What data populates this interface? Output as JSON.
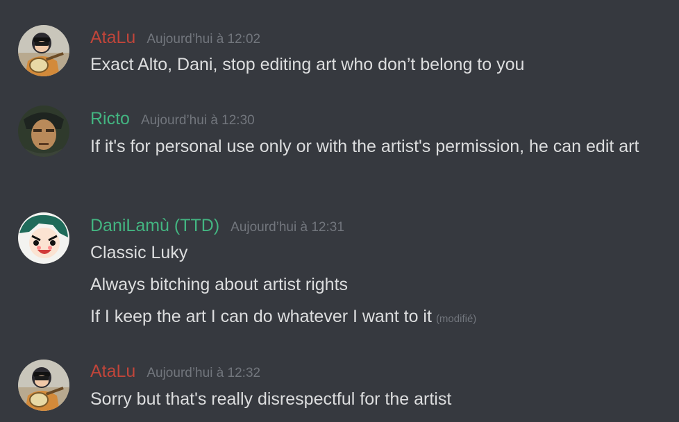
{
  "messages": [
    {
      "author": "AtaLu",
      "author_color": "#c0453a",
      "avatar": "atalu-avatar",
      "timestamp": "Aujourd’hui à 12:02",
      "lines": [
        "Exact Alto, Dani, stop editing art who don’t belong to you"
      ]
    },
    {
      "author": "Ricto",
      "author_color": "#43b581",
      "avatar": "ricto-avatar",
      "timestamp": "Aujourd’hui à 12:30",
      "lines": [
        "If it's for personal use only or with the artist's permission, he can edit art"
      ]
    },
    {
      "author": "DaniLamù (TTD)",
      "author_color": "#43b581",
      "avatar": "danilamu-avatar",
      "timestamp": "Aujourd’hui à 12:31",
      "lines": [
        "Classic Luky",
        "Always bitching about artist rights",
        "If I keep the art I can do whatever I want to it"
      ],
      "edited_label": "(modifié)"
    },
    {
      "author": "AtaLu",
      "author_color": "#c0453a",
      "avatar": "atalu-avatar",
      "timestamp": "Aujourd’hui à 12:32",
      "lines": [
        "Sorry but that's really disrespectful for the artist"
      ]
    }
  ]
}
